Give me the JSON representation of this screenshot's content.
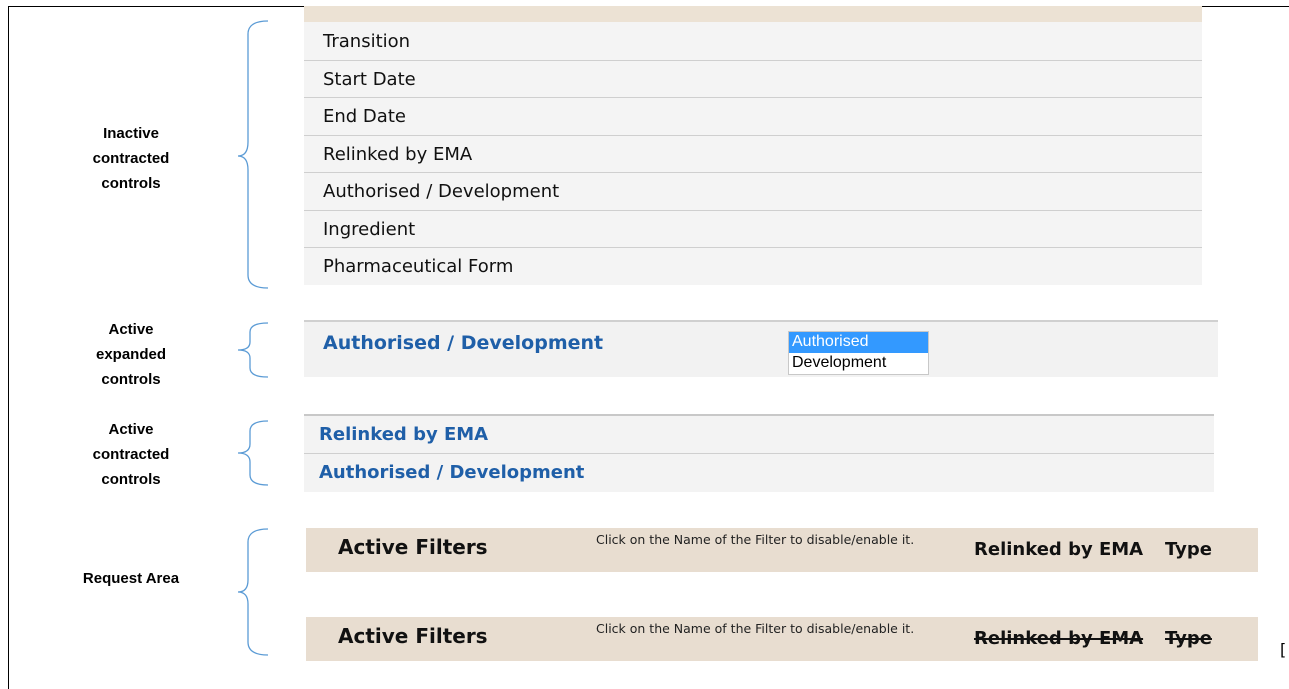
{
  "sections": {
    "inactive": {
      "label": "Inactive contracted controls"
    },
    "expanded": {
      "label": "Active expanded controls"
    },
    "contracted": {
      "label": "Active contracted controls"
    },
    "request": {
      "label": "Request Area"
    }
  },
  "inactive_controls": {
    "items": [
      "Transition",
      "Start Date",
      "End Date",
      "Relinked by EMA",
      "Authorised / Development",
      "Ingredient",
      "Pharmaceutical Form"
    ]
  },
  "expanded_control": {
    "title": "Authorised / Development",
    "options": [
      "Authorised",
      "Development"
    ],
    "selected": "Authorised"
  },
  "contracted_controls": {
    "items": [
      "Relinked by EMA",
      "Authorised / Development"
    ]
  },
  "request_area": {
    "bars": [
      {
        "title": "Active Filters",
        "hint": "Click on the Name of the Filter to disable/enable it.",
        "filters": [
          "Relinked by EMA",
          "Type"
        ],
        "state": "enabled"
      },
      {
        "title": "Active Filters",
        "hint": "Click on the Name of the Filter to disable/enable it.",
        "filters": [
          "Relinked by EMA",
          "Type"
        ],
        "state": "disabled"
      }
    ]
  },
  "trailing_glyph": "[",
  "colors": {
    "brace": "#5b9bd5",
    "active_text": "#1f5fa8",
    "request_bar": "#e8ddd0",
    "panel": "#f4f4f4",
    "selected_option": "#3399ff"
  }
}
